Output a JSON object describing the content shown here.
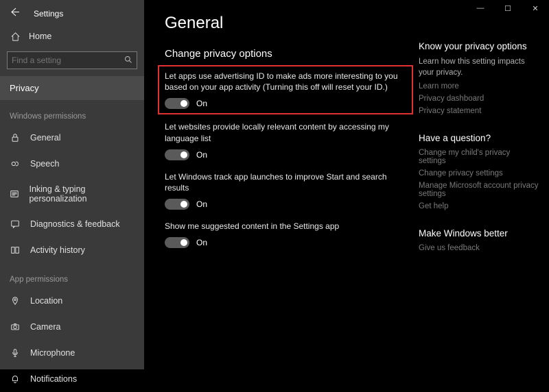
{
  "window": {
    "title": "Settings",
    "minimize": "—",
    "maximize": "☐",
    "close": "✕"
  },
  "sidebar": {
    "home_label": "Home",
    "search_placeholder": "Find a setting",
    "current_page": "Privacy",
    "section_windows": "Windows permissions",
    "section_app": "App permissions",
    "windows_items": [
      {
        "label": "General"
      },
      {
        "label": "Speech"
      },
      {
        "label": "Inking & typing personalization"
      },
      {
        "label": "Diagnostics & feedback"
      },
      {
        "label": "Activity history"
      }
    ],
    "app_items": [
      {
        "label": "Location"
      },
      {
        "label": "Camera"
      },
      {
        "label": "Microphone"
      },
      {
        "label": "Notifications"
      }
    ]
  },
  "main": {
    "title": "General",
    "subtitle": "Change privacy options",
    "settings": [
      {
        "desc": "Let apps use advertising ID to make ads more interesting to you based on your app activity (Turning this off will reset your ID.)",
        "state": "On"
      },
      {
        "desc": "Let websites provide locally relevant content by accessing my language list",
        "state": "On"
      },
      {
        "desc": "Let Windows track app launches to improve Start and search results",
        "state": "On"
      },
      {
        "desc": "Show me suggested content in the Settings app",
        "state": "On"
      }
    ]
  },
  "side": {
    "know_heading": "Know your privacy options",
    "know_text": "Learn how this setting impacts your privacy.",
    "links1": [
      "Learn more",
      "Privacy dashboard",
      "Privacy statement"
    ],
    "question_heading": "Have a question?",
    "links2": [
      "Change my child's privacy settings",
      "Change privacy settings",
      "Manage Microsoft account privacy settings",
      "Get help"
    ],
    "better_heading": "Make Windows better",
    "links3": [
      "Give us feedback"
    ]
  }
}
